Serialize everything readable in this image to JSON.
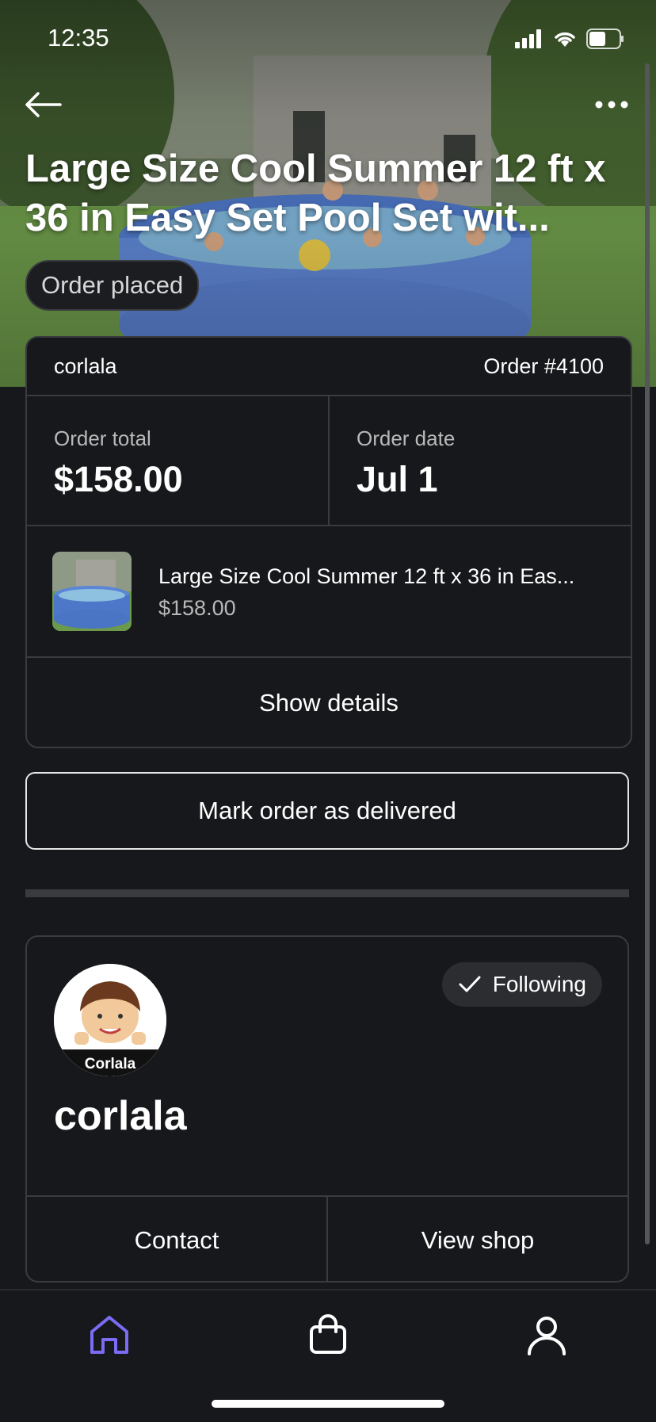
{
  "status_bar": {
    "time": "12:35"
  },
  "hero": {
    "title": "Large Size Cool Summer 12 ft x 36 in Easy Set Pool Set wit...",
    "status_pill": "Order placed"
  },
  "order": {
    "seller": "corlala",
    "order_number": "Order #4100",
    "total_label": "Order total",
    "total_value": "$158.00",
    "date_label": "Order date",
    "date_value": "Jul 1",
    "item_name": "Large Size Cool Summer 12 ft x 36 in Eas...",
    "item_price": "$158.00",
    "show_details": "Show details"
  },
  "mark_delivered": "Mark order as delivered",
  "shop": {
    "avatar_text": "Corlala",
    "following": "Following",
    "name": "corlala",
    "contact": "Contact",
    "view_shop": "View shop"
  },
  "tab_bar": {
    "active_color": "#7b6cf6",
    "items": [
      "home-icon",
      "shopping-bag-icon",
      "profile-icon"
    ]
  }
}
